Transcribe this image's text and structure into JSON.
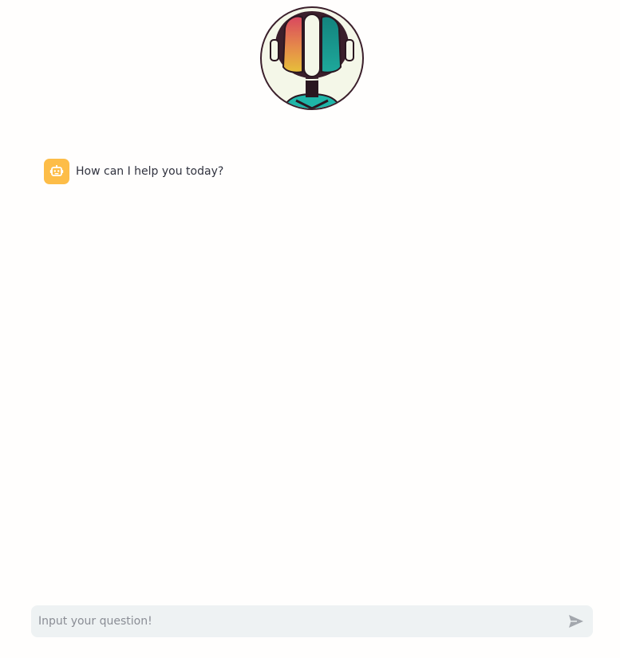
{
  "chat": {
    "messages": [
      {
        "role": "assistant",
        "avatar_icon": "robot-icon",
        "text": "How can I help you today?"
      }
    ]
  },
  "input": {
    "placeholder": "Input your question!",
    "value": ""
  },
  "colors": {
    "avatar_bg": "#fdbd48",
    "input_bg": "#eef2f3",
    "logo_bg": "#f4f7e8",
    "logo_outline": "#3b1f2b",
    "logo_teal": "#1fb5a8"
  }
}
